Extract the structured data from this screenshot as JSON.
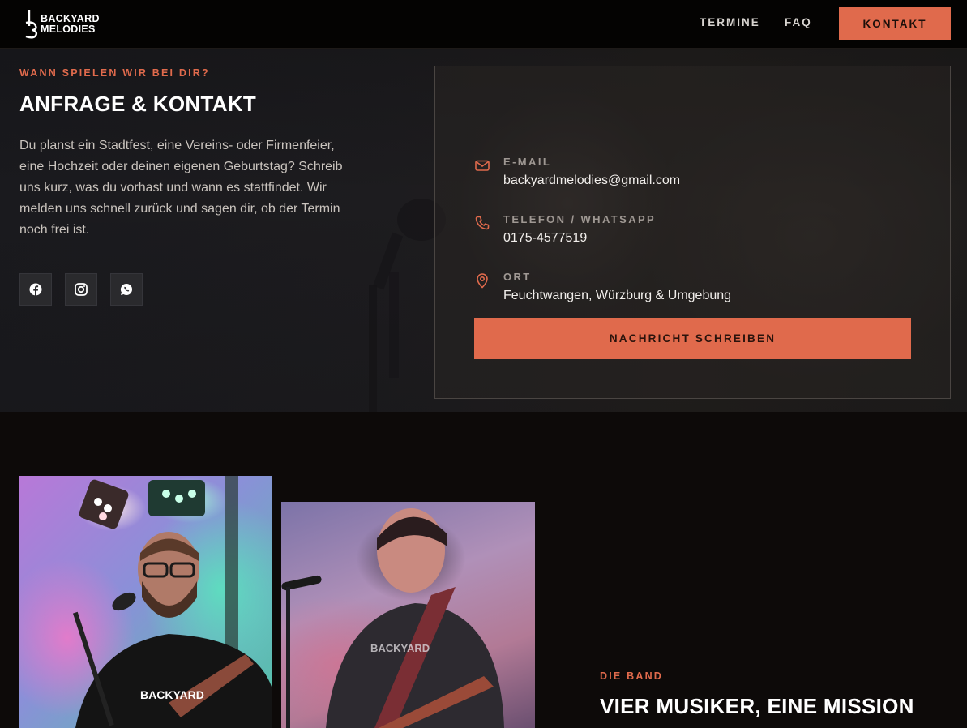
{
  "brand": {
    "logo_text_line1": "BACKYARD",
    "logo_text_line2": "MELODIES"
  },
  "nav": {
    "items": [
      {
        "label": "TERMINE"
      },
      {
        "label": "FAQ"
      }
    ],
    "cta_label": "KONTAKT"
  },
  "contact": {
    "eyebrow": "WANN SPIELEN WIR BEI DIR?",
    "title": "ANFRAGE & KONTAKT",
    "text": "Du planst ein Stadtfest, eine Vereins- oder Firmenfeier, eine Hochzeit oder deinen eigenen Geburtstag? Schreib uns kurz, was du vorhast und wann es stattfindet. Wir melden uns schnell zurück und sagen dir, ob der Termin noch frei ist.",
    "socials": [
      {
        "icon": "facebook-icon"
      },
      {
        "icon": "instagram-icon"
      },
      {
        "icon": "whatsapp-icon"
      }
    ],
    "card": {
      "email": {
        "label": "E-MAIL",
        "value": "backyardmelodies@gmail.com",
        "icon": "mail-icon"
      },
      "phone": {
        "label": "TELEFON / WHATSAPP",
        "value": "0175-4577519",
        "icon": "phone-icon"
      },
      "location": {
        "label": "ORT",
        "value": "Feuchtwangen, Würzburg & Umgebung",
        "icon": "map-pin-icon"
      },
      "button_label": "NACHRICHT SCHREIBEN"
    }
  },
  "band": {
    "eyebrow": "DIE BAND",
    "title": "VIER MUSIKER, EINE MISSION"
  },
  "colors": {
    "accent": "#e06a4c",
    "background": "#0d0a09",
    "navbar": "#040302"
  }
}
